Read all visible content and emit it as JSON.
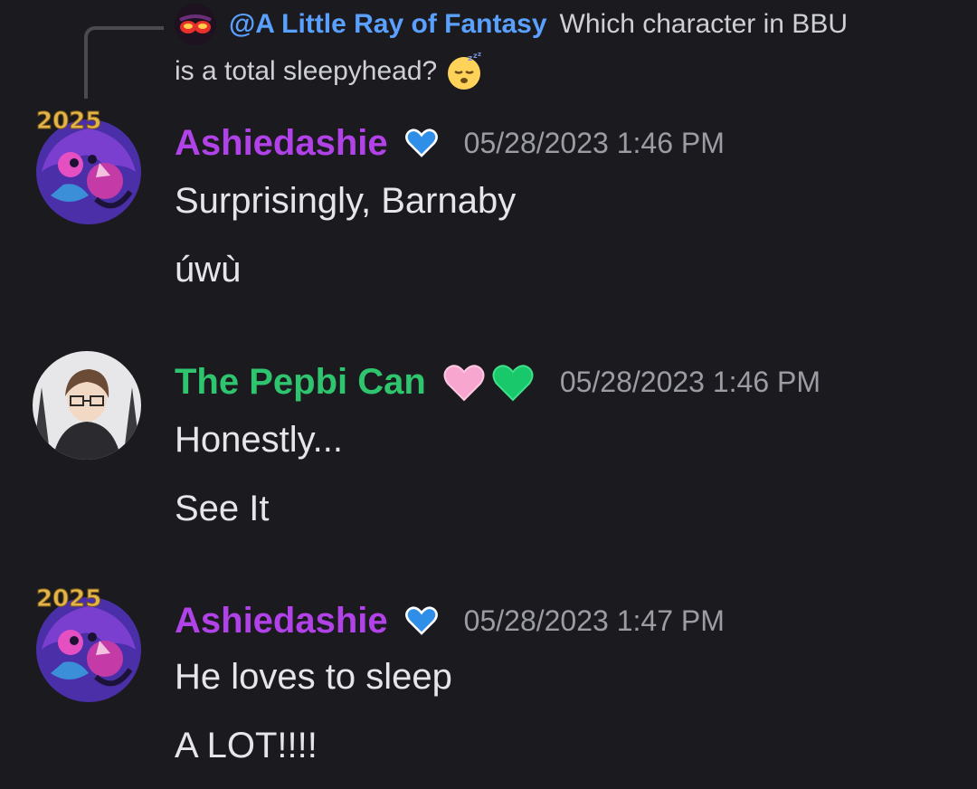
{
  "reply": {
    "mention": "@A Little Ray of Fantasy",
    "text_part1": "Which character in BBU",
    "text_part2": "is a total sleepyhead?",
    "emoji": "sleeping-face-emoji"
  },
  "messages": [
    {
      "username": "Ashiedashie",
      "badge": "blue-heart-emoji",
      "timestamp": "05/28/2023 1:46 PM",
      "lines": [
        "Surprisingly, Barnaby",
        "úwù"
      ],
      "avatar_text": "2025"
    },
    {
      "username": "The Pepbi Can",
      "badge": "pink-heart-green-heart-emoji",
      "timestamp": "05/28/2023 1:46 PM",
      "lines": [
        "Honestly...",
        "See It"
      ]
    },
    {
      "username": "Ashiedashie",
      "badge": "blue-heart-emoji",
      "timestamp": "05/28/2023 1:47 PM",
      "lines": [
        "He loves to sleep",
        "A LOT!!!!"
      ],
      "avatar_text": "2025"
    }
  ],
  "colors": {
    "background": "#1b1b1f",
    "mention": "#5aa0ff",
    "username_purple": "#b042e8",
    "username_green": "#2fc56e",
    "timestamp": "#9b9ca4",
    "message_text": "#e6e6ea"
  }
}
